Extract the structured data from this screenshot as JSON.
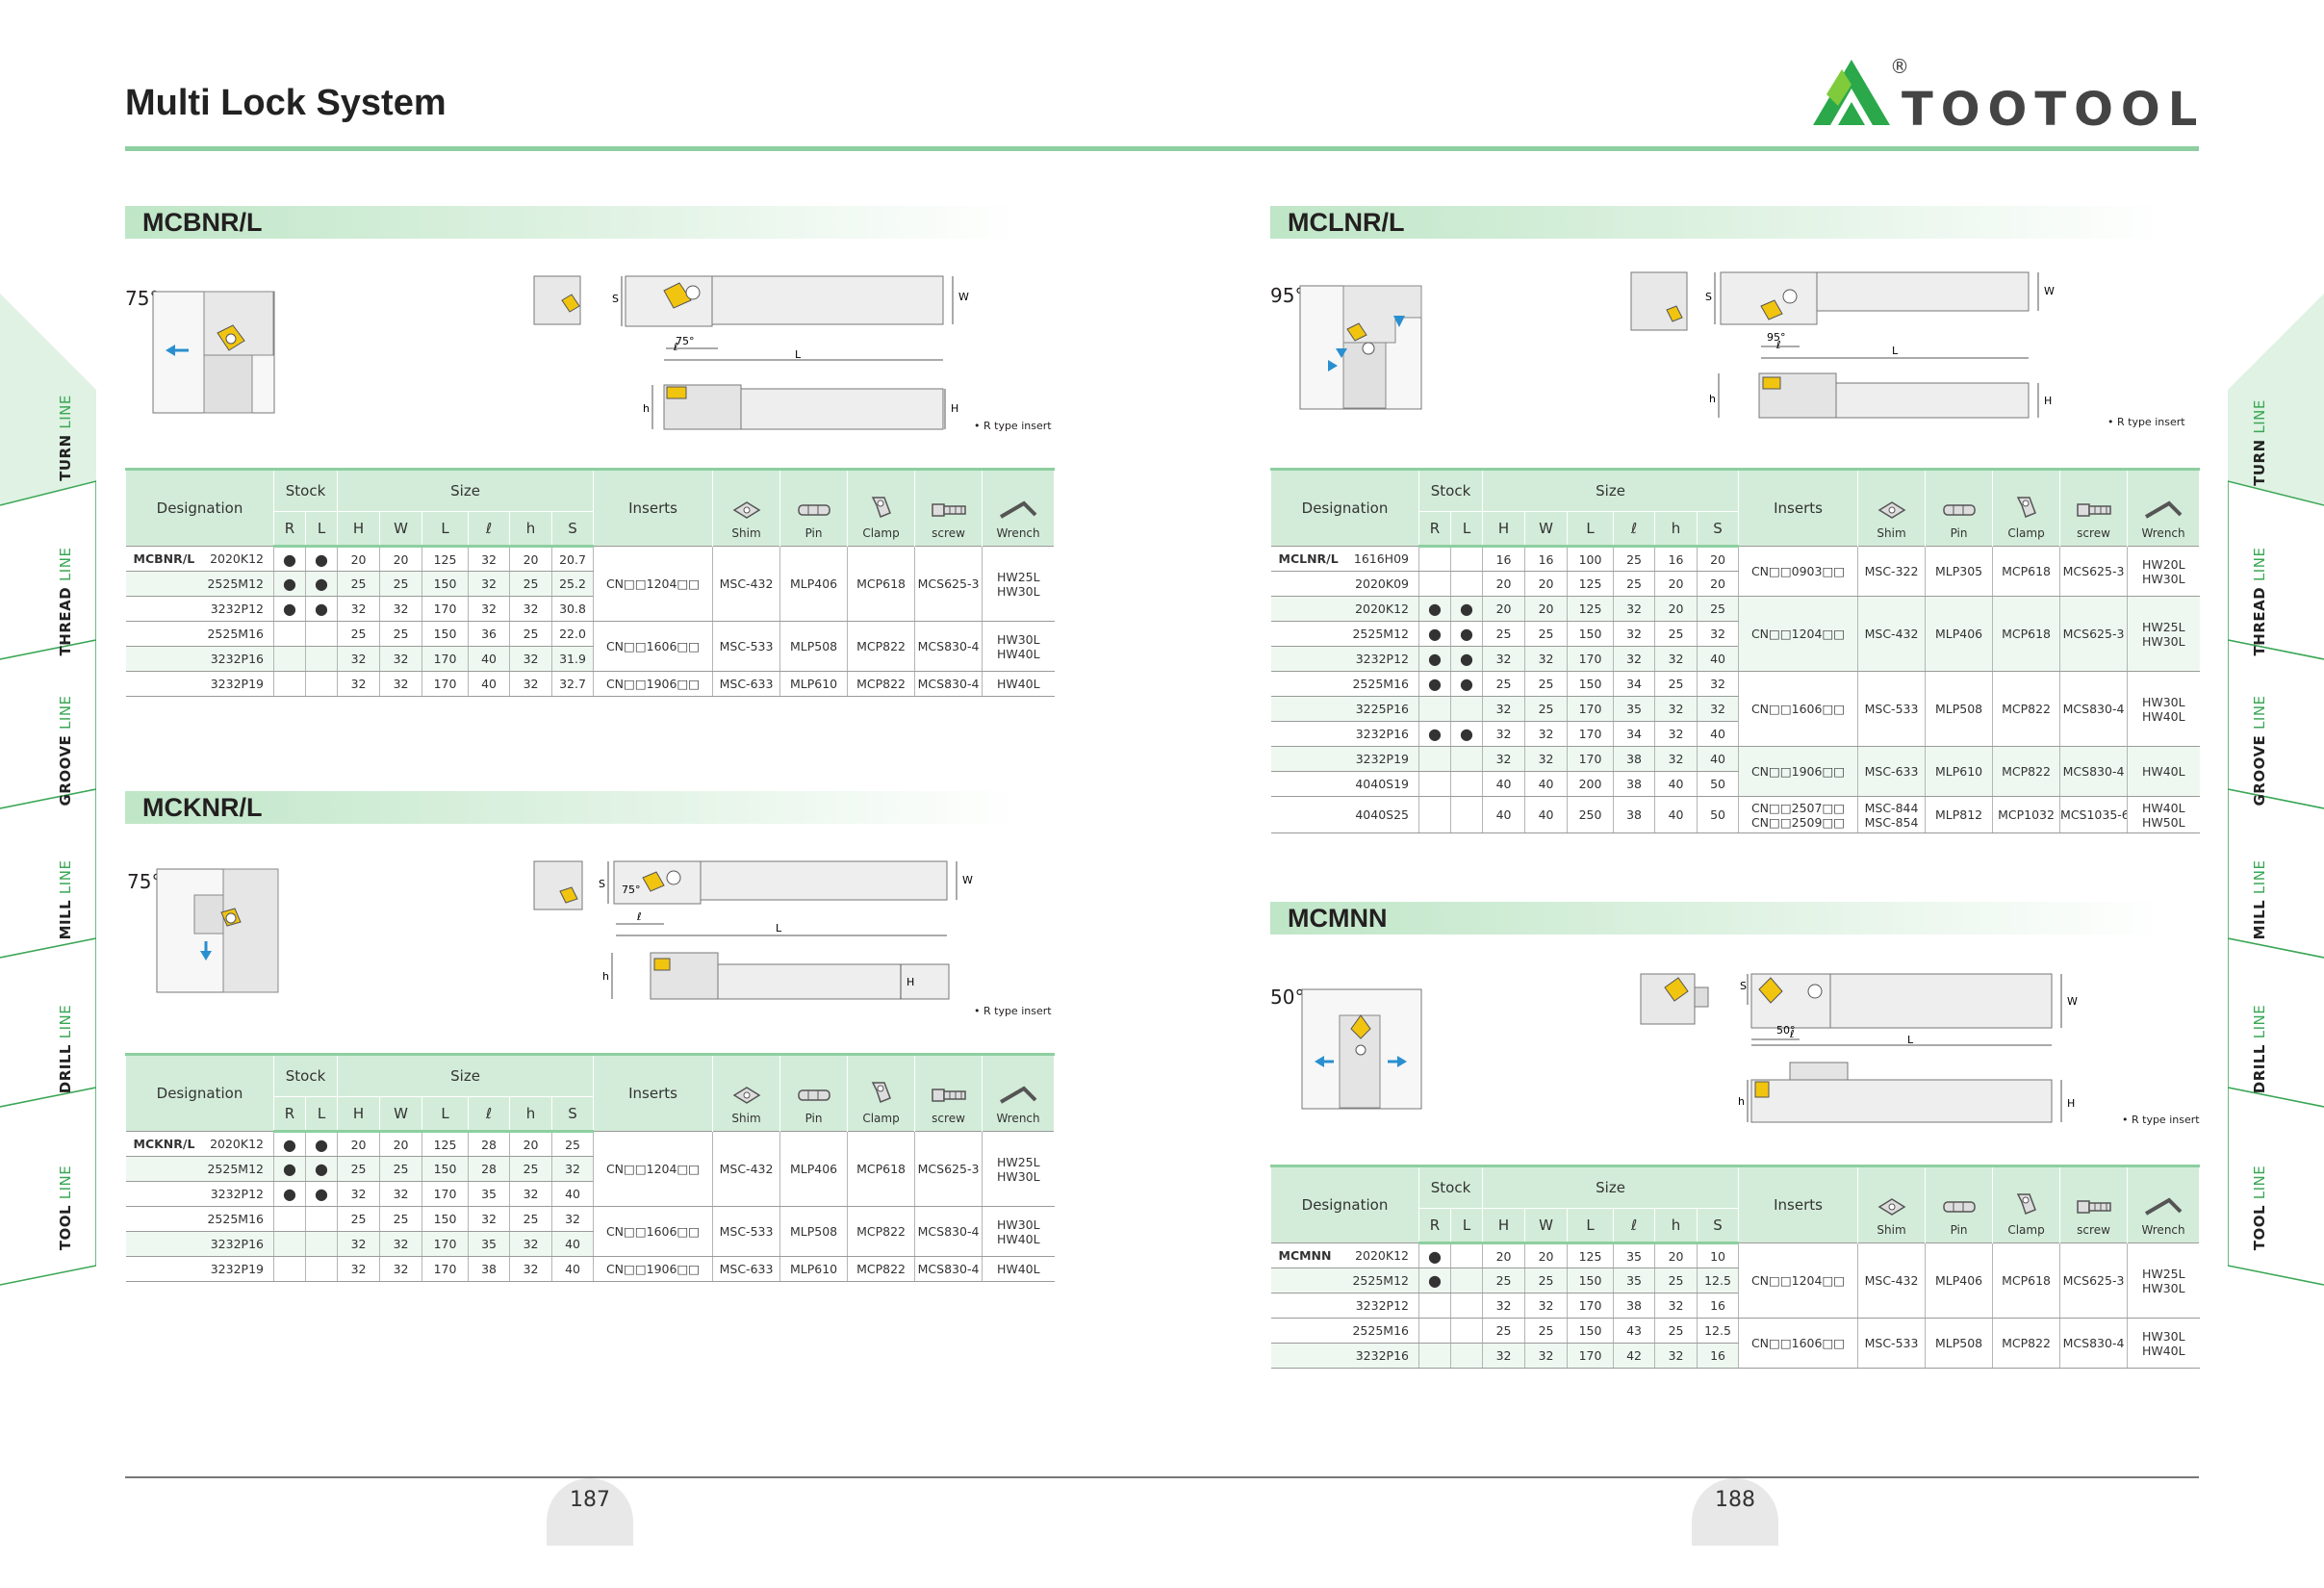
{
  "header": {
    "title": "Multi Lock System",
    "brand": "TOOTOOL",
    "registered": "®"
  },
  "footer": {
    "left_page": "187",
    "right_page": "188"
  },
  "side_tabs": [
    {
      "strong": "TURN",
      "light": "LINE"
    },
    {
      "strong": "THREAD",
      "light": "LINE"
    },
    {
      "strong": "GROOVE",
      "light": "LINE"
    },
    {
      "strong": "MILL",
      "light": "LINE"
    },
    {
      "strong": "DRILL",
      "light": "LINE"
    },
    {
      "strong": "TOOL",
      "light": "LINE"
    }
  ],
  "table_headers": {
    "designation": "Designation",
    "stock": "Stock",
    "size": "Size",
    "inserts": "Inserts",
    "R": "R",
    "L": "L",
    "H": "H",
    "W": "W",
    "Lcol": "L",
    "l": "ℓ",
    "h": "h",
    "S": "S",
    "shim": "Shim",
    "pin": "Pin",
    "clamp": "Clamp",
    "screw": "screw",
    "wrench": "Wrench"
  },
  "diagram_labels": {
    "S": "S",
    "W": "W",
    "L": "L",
    "l": "ℓ",
    "h": "h",
    "H": "H",
    "r_type": "• R type insert"
  },
  "mcbnr": {
    "title": "MCBNR/L",
    "angle": "75°",
    "diag_angle": "75°",
    "rows": [
      {
        "prefix": "MCBNR/L",
        "code": "2020K12",
        "R": "●",
        "L": "●",
        "H": "20",
        "W": "20",
        "Lv": "125",
        "l": "32",
        "h": "20",
        "S": "20.7"
      },
      {
        "prefix": "",
        "code": "2525M12",
        "R": "●",
        "L": "●",
        "H": "25",
        "W": "25",
        "Lv": "150",
        "l": "32",
        "h": "25",
        "S": "25.2"
      },
      {
        "prefix": "",
        "code": "3232P12",
        "R": "●",
        "L": "●",
        "H": "32",
        "W": "32",
        "Lv": "170",
        "l": "32",
        "h": "32",
        "S": "30.8"
      },
      {
        "prefix": "",
        "code": "2525M16",
        "R": "",
        "L": "",
        "H": "25",
        "W": "25",
        "Lv": "150",
        "l": "36",
        "h": "25",
        "S": "22.0"
      },
      {
        "prefix": "",
        "code": "3232P16",
        "R": "",
        "L": "",
        "H": "32",
        "W": "32",
        "Lv": "170",
        "l": "40",
        "h": "32",
        "S": "31.9"
      },
      {
        "prefix": "",
        "code": "3232P19",
        "R": "",
        "L": "",
        "H": "32",
        "W": "32",
        "Lv": "170",
        "l": "40",
        "h": "32",
        "S": "32.7"
      }
    ],
    "groups": [
      {
        "insert": "CN□□1204□□",
        "shim": "MSC-432",
        "pin": "MLP406",
        "clamp": "MCP618",
        "screw": "MCS625-3",
        "wrench": "HW25L HW30L"
      },
      {
        "insert": "CN□□1606□□",
        "shim": "MSC-533",
        "pin": "MLP508",
        "clamp": "MCP822",
        "screw": "MCS830-4",
        "wrench": "HW30L HW40L"
      },
      {
        "insert": "CN□□1906□□",
        "shim": "MSC-633",
        "pin": "MLP610",
        "clamp": "MCP822",
        "screw": "MCS830-4",
        "wrench": "HW40L"
      }
    ]
  },
  "mcknr": {
    "title": "MCKNR/L",
    "angle": "75°",
    "diag_angle": "75°",
    "rows": [
      {
        "prefix": "MCKNR/L",
        "code": "2020K12",
        "R": "●",
        "L": "●",
        "H": "20",
        "W": "20",
        "Lv": "125",
        "l": "28",
        "h": "20",
        "S": "25"
      },
      {
        "prefix": "",
        "code": "2525M12",
        "R": "●",
        "L": "●",
        "H": "25",
        "W": "25",
        "Lv": "150",
        "l": "28",
        "h": "25",
        "S": "32"
      },
      {
        "prefix": "",
        "code": "3232P12",
        "R": "●",
        "L": "●",
        "H": "32",
        "W": "32",
        "Lv": "170",
        "l": "35",
        "h": "32",
        "S": "40"
      },
      {
        "prefix": "",
        "code": "2525M16",
        "R": "",
        "L": "",
        "H": "25",
        "W": "25",
        "Lv": "150",
        "l": "32",
        "h": "25",
        "S": "32"
      },
      {
        "prefix": "",
        "code": "3232P16",
        "R": "",
        "L": "",
        "H": "32",
        "W": "32",
        "Lv": "170",
        "l": "35",
        "h": "32",
        "S": "40"
      },
      {
        "prefix": "",
        "code": "3232P19",
        "R": "",
        "L": "",
        "H": "32",
        "W": "32",
        "Lv": "170",
        "l": "38",
        "h": "32",
        "S": "40"
      }
    ],
    "groups": [
      {
        "insert": "CN□□1204□□",
        "shim": "MSC-432",
        "pin": "MLP406",
        "clamp": "MCP618",
        "screw": "MCS625-3",
        "wrench": "HW25L HW30L"
      },
      {
        "insert": "CN□□1606□□",
        "shim": "MSC-533",
        "pin": "MLP508",
        "clamp": "MCP822",
        "screw": "MCS830-4",
        "wrench": "HW30L HW40L"
      },
      {
        "insert": "CN□□1906□□",
        "shim": "MSC-633",
        "pin": "MLP610",
        "clamp": "MCP822",
        "screw": "MCS830-4",
        "wrench": "HW40L"
      }
    ]
  },
  "mclnr": {
    "title": "MCLNR/L",
    "angle": "95°",
    "diag_angle": "95°",
    "rows": [
      {
        "prefix": "MCLNR/L",
        "code": "1616H09",
        "R": "",
        "L": "",
        "H": "16",
        "W": "16",
        "Lv": "100",
        "l": "25",
        "h": "16",
        "S": "20"
      },
      {
        "prefix": "",
        "code": "2020K09",
        "R": "",
        "L": "",
        "H": "20",
        "W": "20",
        "Lv": "125",
        "l": "25",
        "h": "20",
        "S": "20"
      },
      {
        "prefix": "",
        "code": "2020K12",
        "R": "●",
        "L": "●",
        "H": "20",
        "W": "20",
        "Lv": "125",
        "l": "32",
        "h": "20",
        "S": "25"
      },
      {
        "prefix": "",
        "code": "2525M12",
        "R": "●",
        "L": "●",
        "H": "25",
        "W": "25",
        "Lv": "150",
        "l": "32",
        "h": "25",
        "S": "32"
      },
      {
        "prefix": "",
        "code": "3232P12",
        "R": "●",
        "L": "●",
        "H": "32",
        "W": "32",
        "Lv": "170",
        "l": "32",
        "h": "32",
        "S": "40"
      },
      {
        "prefix": "",
        "code": "2525M16",
        "R": "●",
        "L": "●",
        "H": "25",
        "W": "25",
        "Lv": "150",
        "l": "34",
        "h": "25",
        "S": "32"
      },
      {
        "prefix": "",
        "code": "3225P16",
        "R": "",
        "L": "",
        "H": "32",
        "W": "25",
        "Lv": "170",
        "l": "35",
        "h": "32",
        "S": "32"
      },
      {
        "prefix": "",
        "code": "3232P16",
        "R": "●",
        "L": "●",
        "H": "32",
        "W": "32",
        "Lv": "170",
        "l": "34",
        "h": "32",
        "S": "40"
      },
      {
        "prefix": "",
        "code": "3232P19",
        "R": "",
        "L": "",
        "H": "32",
        "W": "32",
        "Lv": "170",
        "l": "38",
        "h": "32",
        "S": "40"
      },
      {
        "prefix": "",
        "code": "4040S19",
        "R": "",
        "L": "",
        "H": "40",
        "W": "40",
        "Lv": "200",
        "l": "38",
        "h": "40",
        "S": "50"
      },
      {
        "prefix": "",
        "code": "4040S25",
        "R": "",
        "L": "",
        "H": "40",
        "W": "40",
        "Lv": "250",
        "l": "38",
        "h": "40",
        "S": "50"
      }
    ],
    "groups": [
      {
        "insert": "CN□□0903□□",
        "shim": "MSC-322",
        "pin": "MLP305",
        "clamp": "MCP618",
        "screw": "MCS625-3",
        "wrench": "HW20L HW30L"
      },
      {
        "insert": "CN□□1204□□",
        "shim": "MSC-432",
        "pin": "MLP406",
        "clamp": "MCP618",
        "screw": "MCS625-3",
        "wrench": "HW25L HW30L"
      },
      {
        "insert": "CN□□1606□□",
        "shim": "MSC-533",
        "pin": "MLP508",
        "clamp": "MCP822",
        "screw": "MCS830-4",
        "wrench": "HW30L HW40L"
      },
      {
        "insert": "CN□□1906□□",
        "shim": "MSC-633",
        "pin": "MLP610",
        "clamp": "MCP822",
        "screw": "MCS830-4",
        "wrench": "HW40L"
      },
      {
        "insert": "CN□□2507□□ CN□□2509□□",
        "shim": "MSC-844 MSC-854",
        "pin": "MLP812",
        "clamp": "MCP1032",
        "screw": "MCS1035-6",
        "wrench": "HW40L HW50L"
      }
    ]
  },
  "mcmnn": {
    "title": "MCMNN",
    "angle": "50°",
    "diag_angle": "50°",
    "rows": [
      {
        "prefix": "MCMNN",
        "code": "2020K12",
        "R": "●",
        "L": "",
        "H": "20",
        "W": "20",
        "Lv": "125",
        "l": "35",
        "h": "20",
        "S": "10"
      },
      {
        "prefix": "",
        "code": "2525M12",
        "R": "●",
        "L": "",
        "H": "25",
        "W": "25",
        "Lv": "150",
        "l": "35",
        "h": "25",
        "S": "12.5"
      },
      {
        "prefix": "",
        "code": "3232P12",
        "R": "",
        "L": "",
        "H": "32",
        "W": "32",
        "Lv": "170",
        "l": "38",
        "h": "32",
        "S": "16"
      },
      {
        "prefix": "",
        "code": "2525M16",
        "R": "",
        "L": "",
        "H": "25",
        "W": "25",
        "Lv": "150",
        "l": "43",
        "h": "25",
        "S": "12.5"
      },
      {
        "prefix": "",
        "code": "3232P16",
        "R": "",
        "L": "",
        "H": "32",
        "W": "32",
        "Lv": "170",
        "l": "42",
        "h": "32",
        "S": "16"
      }
    ],
    "groups": [
      {
        "insert": "CN□□1204□□",
        "shim": "MSC-432",
        "pin": "MLP406",
        "clamp": "MCP618",
        "screw": "MCS625-3",
        "wrench": "HW25L HW30L"
      },
      {
        "insert": "CN□□1606□□",
        "shim": "MSC-533",
        "pin": "MLP508",
        "clamp": "MCP822",
        "screw": "MCS830-4",
        "wrench": "HW30L HW40L"
      }
    ]
  }
}
